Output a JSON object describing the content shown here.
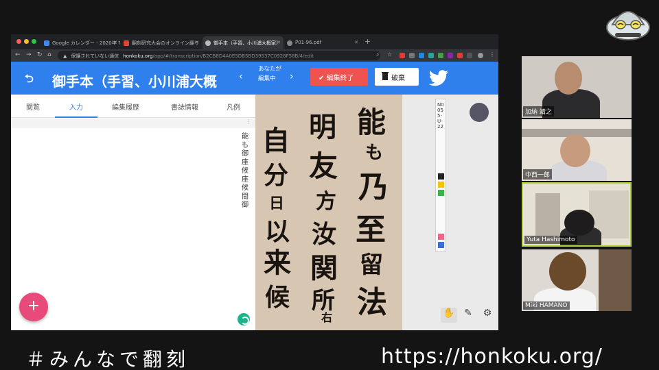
{
  "browser": {
    "tabs": [
      {
        "title": "Google カレンダー - 2020年 7",
        "active": false,
        "favicon_color": "#4285f4"
      },
      {
        "title": "翻刻研究大会のオンライン翻り",
        "active": false,
        "favicon_color": "#e94235"
      },
      {
        "title": "御手本（手習、小川浦大概家）",
        "active": true,
        "favicon_color": "#bbbbbb"
      },
      {
        "title": "P01-96.pdf",
        "active": false,
        "favicon_color": "#888888"
      }
    ],
    "url": {
      "security_warning": "保護されていない通信",
      "host": "honkoku.org",
      "path": "/app/#/transcription/B2CB8D4A0E5DB5BD39537C0928F58B/4/edit"
    }
  },
  "app": {
    "back_icon": "arrow-back-icon",
    "doc_title": "御手本（手習、小川浦大概",
    "editing_notice": "あなたが編集中",
    "end_edit_label": "編集終了",
    "discard_label": "破棄",
    "tabs": [
      "閲覧",
      "入力",
      "編集履歴",
      "書誌情報",
      "凡例"
    ],
    "active_tab": "入力",
    "transcription_text": "能も御座候座候間御",
    "fab_label": "+",
    "accent_color": "#2f80ed",
    "end_edit_color": "#ef5350",
    "fab_color": "#e84a7a"
  },
  "viewer": {
    "scale_label": "N0055-U-22",
    "tools": [
      "hand-icon",
      "pencil-icon",
      "robot-icon"
    ]
  },
  "participants": [
    {
      "name": "加納 靖之",
      "active": false
    },
    {
      "name": "中西一郎",
      "active": false
    },
    {
      "name": "Yuta Hashimoto",
      "active": true
    },
    {
      "name": "Miki HAMANO",
      "active": false
    }
  ],
  "footer": {
    "hashtag": "＃みんなで翻刻",
    "url": "https://honkoku.org/"
  }
}
